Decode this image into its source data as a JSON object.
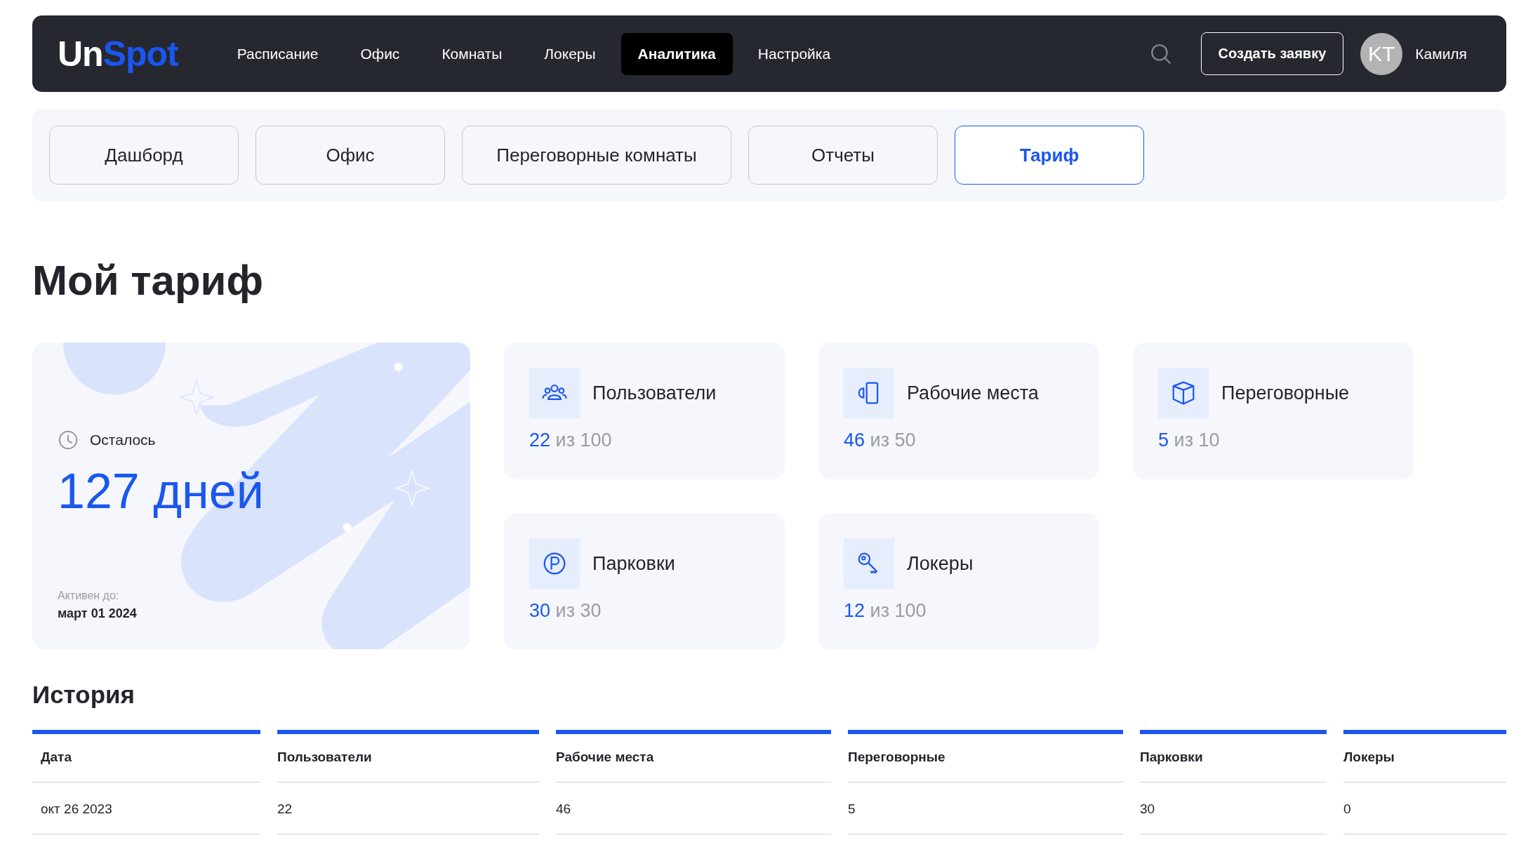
{
  "header": {
    "logo": {
      "first": "Un",
      "second": "Spot"
    },
    "nav": [
      {
        "label": "Расписание",
        "selected": false
      },
      {
        "label": "Офис",
        "selected": false
      },
      {
        "label": "Комнаты",
        "selected": false
      },
      {
        "label": "Локеры",
        "selected": false
      },
      {
        "label": "Аналитика",
        "selected": true
      },
      {
        "label": "Настройка",
        "selected": false
      }
    ],
    "create_button": "Создать заявку",
    "user": {
      "initials": "KT",
      "name": "Камиля"
    }
  },
  "subtabs": [
    {
      "label": "Дашборд",
      "selected": false
    },
    {
      "label": "Офис",
      "selected": false
    },
    {
      "label": "Переговорные комнаты",
      "selected": false
    },
    {
      "label": "Отчеты",
      "selected": false
    },
    {
      "label": "Тариф",
      "selected": true
    }
  ],
  "title": "Мой тариф",
  "plan_card": {
    "remaining_label": "Осталось",
    "remaining": "127 дней",
    "active_until_label": "Активен до:",
    "active_until": "март 01 2024"
  },
  "stats": [
    {
      "kind": "users",
      "label": "Пользователи",
      "used": "22",
      "total": "из 100"
    },
    {
      "kind": "desk",
      "label": "Рабочие места",
      "used": "46",
      "total": "из 50"
    },
    {
      "kind": "room",
      "label": "Переговорные",
      "used": "5",
      "total": "из 10"
    },
    {
      "kind": "parking",
      "label": "Парковки",
      "used": "30",
      "total": "из 30"
    },
    {
      "kind": "locker",
      "label": "Локеры",
      "used": "12",
      "total": "из 100"
    }
  ],
  "history": {
    "title": "История",
    "columns": [
      "Дата",
      "Пользователи",
      "Рабочие места",
      "Переговорные",
      "Парковки",
      "Локеры"
    ],
    "rows": [
      [
        "окт 26 2023",
        "22",
        "46",
        "5",
        "30",
        "0"
      ]
    ]
  }
}
